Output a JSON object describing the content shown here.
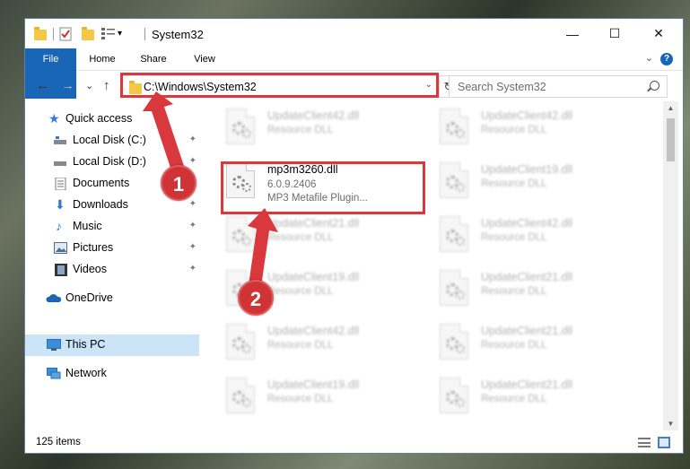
{
  "window": {
    "title": "System32",
    "minimize_glyph": "—",
    "maximize_glyph": "☐",
    "close_glyph": "✕"
  },
  "quick_access_toolbar": {
    "dropdown_glyph": "▾"
  },
  "ribbon": {
    "tabs": [
      "File",
      "Home",
      "Share",
      "View"
    ],
    "help_glyph": "?",
    "collapse_glyph": "⌄"
  },
  "navigation": {
    "back_glyph": "←",
    "forward_glyph": "→",
    "recent_glyph": "⌄",
    "up_glyph": "↑"
  },
  "address_bar": {
    "path": "C:\\Windows\\System32",
    "dropdown_glyph": "⌄",
    "refresh_glyph": "↻"
  },
  "search": {
    "placeholder": "Search System32"
  },
  "sidebar": {
    "items": [
      {
        "label": "Quick access",
        "icon": "star-icon"
      },
      {
        "label": "Local Disk (C:)",
        "icon": "drive-icon"
      },
      {
        "label": "Local Disk (D:)",
        "icon": "drive-icon"
      },
      {
        "label": "Documents",
        "icon": "documents-icon"
      },
      {
        "label": "Downloads",
        "icon": "downloads-icon"
      },
      {
        "label": "Music",
        "icon": "music-icon"
      },
      {
        "label": "Pictures",
        "icon": "pictures-icon"
      },
      {
        "label": "Videos",
        "icon": "videos-icon"
      },
      {
        "label": "OneDrive",
        "icon": "onedrive-icon"
      },
      {
        "label": "This PC",
        "icon": "computer-icon"
      },
      {
        "label": "Network",
        "icon": "network-icon"
      }
    ],
    "pin_glyph": "📌"
  },
  "files": [
    {
      "name": "UpdateClient42.dll",
      "line2": "",
      "line3": "Resource DLL",
      "blurred": true
    },
    {
      "name": "UpdateClient42.dll",
      "line2": "",
      "line3": "Resource DLL",
      "blurred": true
    },
    {
      "name": "mp3m3260.dll",
      "line2": "6.0.9.2406",
      "line3": "MP3 Metafile Plugin...",
      "blurred": false
    },
    {
      "name": "UpdateClient19.dll",
      "line2": "",
      "line3": "Resource DLL",
      "blurred": true
    },
    {
      "name": "UpdateClient21.dll",
      "line2": "",
      "line3": "Resource DLL",
      "blurred": true
    },
    {
      "name": "UpdateClient42.dll",
      "line2": "",
      "line3": "Resource DLL",
      "blurred": true
    },
    {
      "name": "UpdateClient19.dll",
      "line2": "",
      "line3": "Resource DLL",
      "blurred": true
    },
    {
      "name": "UpdateClient21.dll",
      "line2": "",
      "line3": "Resource DLL",
      "blurred": true
    },
    {
      "name": "UpdateClient42.dll",
      "line2": "",
      "line3": "Resource DLL",
      "blurred": true
    },
    {
      "name": "UpdateClient21.dll",
      "line2": "",
      "line3": "Resource DLL",
      "blurred": true
    },
    {
      "name": "UpdateClient19.dll",
      "line2": "",
      "line3": "Resource DLL",
      "blurred": true
    },
    {
      "name": "UpdateClient21.dll",
      "line2": "",
      "line3": "Resource DLL",
      "blurred": true
    }
  ],
  "status_bar": {
    "item_count": "125 items"
  },
  "annotations": {
    "badge_1": "1",
    "badge_2": "2",
    "color": "#d9383c"
  },
  "colors": {
    "accent": "#1a66b6",
    "selection": "#cce4f7",
    "folder": "#f4c844"
  }
}
